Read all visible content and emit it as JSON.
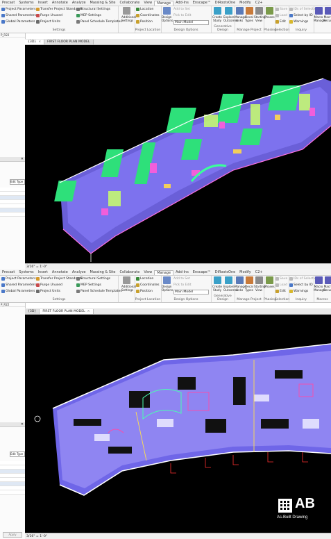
{
  "menubar": [
    "Precast",
    "Systems",
    "Insert",
    "Annotate",
    "Analyze",
    "Massing & Site",
    "Collaborate",
    "View",
    "Manage",
    "Add-Ins",
    "Enscape™",
    "DiRootsOne",
    "Modify",
    "C2+"
  ],
  "menubar_active": "Manage",
  "settings": {
    "items": [
      "Project Parameters",
      "Shared Parameters",
      "Global Parameters",
      "Transfer Project Standards",
      "Purge Unused",
      "Project Units",
      "Structural Settings",
      "MEP Settings",
      "Panel Schedule Templates"
    ],
    "additional": "Additional Settings",
    "label": "Settings"
  },
  "project_location": {
    "items": [
      "Location",
      "Coordinates",
      "Position"
    ],
    "label": "Project Location"
  },
  "design_options": {
    "btn": "Design Options",
    "field": "Main Model",
    "items": [
      "Add to Set",
      "Pick to Edit"
    ],
    "label": "Design Options"
  },
  "generative": {
    "btns": [
      "Create Study",
      "Explore Outcomes"
    ],
    "label": "Generative Design"
  },
  "manage_project": {
    "btns": [
      "Manage Links",
      "Decal Types",
      "Starting View"
    ],
    "label": "Manage Project"
  },
  "phasing": {
    "btn": "Phases",
    "label": "Phasing"
  },
  "selection": {
    "items": [
      "Save",
      "Load",
      "Edit"
    ],
    "label": "Selection"
  },
  "inquiry": {
    "items": [
      "IDs of Selection",
      "Select by ID",
      "Warnings"
    ],
    "label": "Inquiry"
  },
  "macros": {
    "btns": [
      "Macro Manager",
      "Macro Security"
    ],
    "label": "Macros"
  },
  "left_panel": {
    "header": "Edit Type",
    "items": [
      "P_R22"
    ]
  },
  "top_tabs": [
    {
      "label": "{3D}",
      "active": true
    },
    {
      "label": "FIRST FLOOR PLAN MODEL",
      "active": false
    }
  ],
  "bottom_tabs": [
    {
      "label": "{3D}",
      "active": false
    },
    {
      "label": "FIRST FLOOR PLAN MODEL",
      "active": true
    }
  ],
  "status_scale": "3/16\" = 1'-0\"",
  "apply_label": "Apply",
  "logo": {
    "text": "AB",
    "tagline": "As-Built Drawing"
  },
  "colors": {
    "ribbon": "#f7f7f7",
    "viewport": "#000000",
    "wall_blue": "#3c3cff",
    "floor_purple": "#8a7cf0",
    "furniture_green": "#36e67a"
  }
}
